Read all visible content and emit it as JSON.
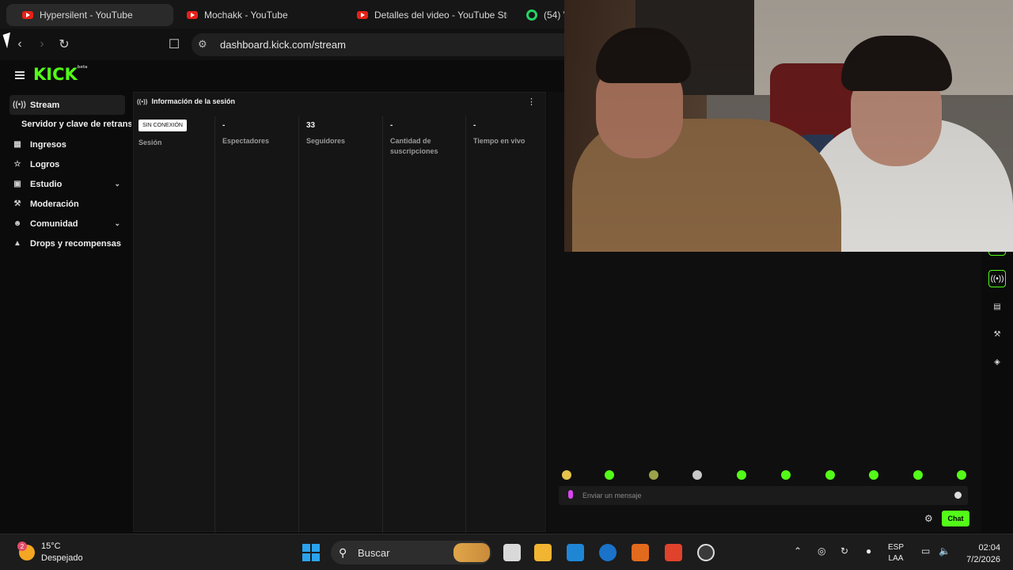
{
  "browser": {
    "tabs": [
      {
        "title": "Hypersilent - YouTube",
        "icon": "youtube-icon",
        "active": true
      },
      {
        "title": "Mochakk - YouTube",
        "icon": "youtube-icon",
        "active": false
      },
      {
        "title": "Detalles del video - YouTube Stud",
        "icon": "youtube-icon",
        "active": false
      },
      {
        "title": "(54) V",
        "icon": "whatsapp-icon",
        "active": false
      }
    ],
    "url": "dashboard.kick.com/stream"
  },
  "kick": {
    "logo": "KICK",
    "logo_suffix": "beta"
  },
  "sidebar": {
    "items": [
      {
        "label": "Stream",
        "icon": "broadcast-icon",
        "active": true,
        "expandable": false
      },
      {
        "label": "Ingresos",
        "icon": "revenue-icon",
        "active": false,
        "expandable": false
      },
      {
        "label": "Logros",
        "icon": "trophy-icon",
        "active": false,
        "expandable": false
      },
      {
        "label": "Estudio",
        "icon": "studio-icon",
        "active": false,
        "expandable": true
      },
      {
        "label": "Moderación",
        "icon": "wrench-icon",
        "active": false,
        "expandable": false
      },
      {
        "label": "Comunidad",
        "icon": "community-icon",
        "active": false,
        "expandable": true
      },
      {
        "label": "Drops y recompensas",
        "icon": "drops-icon",
        "active": false,
        "expandable": false
      }
    ],
    "subitem": "Servidor y clave de retransm"
  },
  "session": {
    "title": "Información de la sesión",
    "stats": [
      {
        "value": "SIN CONEXIÓN",
        "label": "Sesión",
        "badge": true
      },
      {
        "value": "-",
        "label": "Espectadores"
      },
      {
        "value": "33",
        "label": "Seguidores"
      },
      {
        "value": "-",
        "label": "Cantidad de suscripciones"
      },
      {
        "value": "-",
        "label": "Tiempo en vivo"
      }
    ]
  },
  "chat": {
    "placeholder": "Enviar un mensaje",
    "send_label": "Chat"
  },
  "taskbar": {
    "weather_temp": "15°C",
    "weather_desc": "Despejado",
    "weather_badge": "2",
    "search_label": "Buscar",
    "lang_top": "ESP",
    "lang_bottom": "LAA",
    "time": "02:04",
    "date": "7/2/2026"
  },
  "colors": {
    "kick_green": "#53fc18",
    "background": "#0b0b0b",
    "panel": "#151515"
  }
}
